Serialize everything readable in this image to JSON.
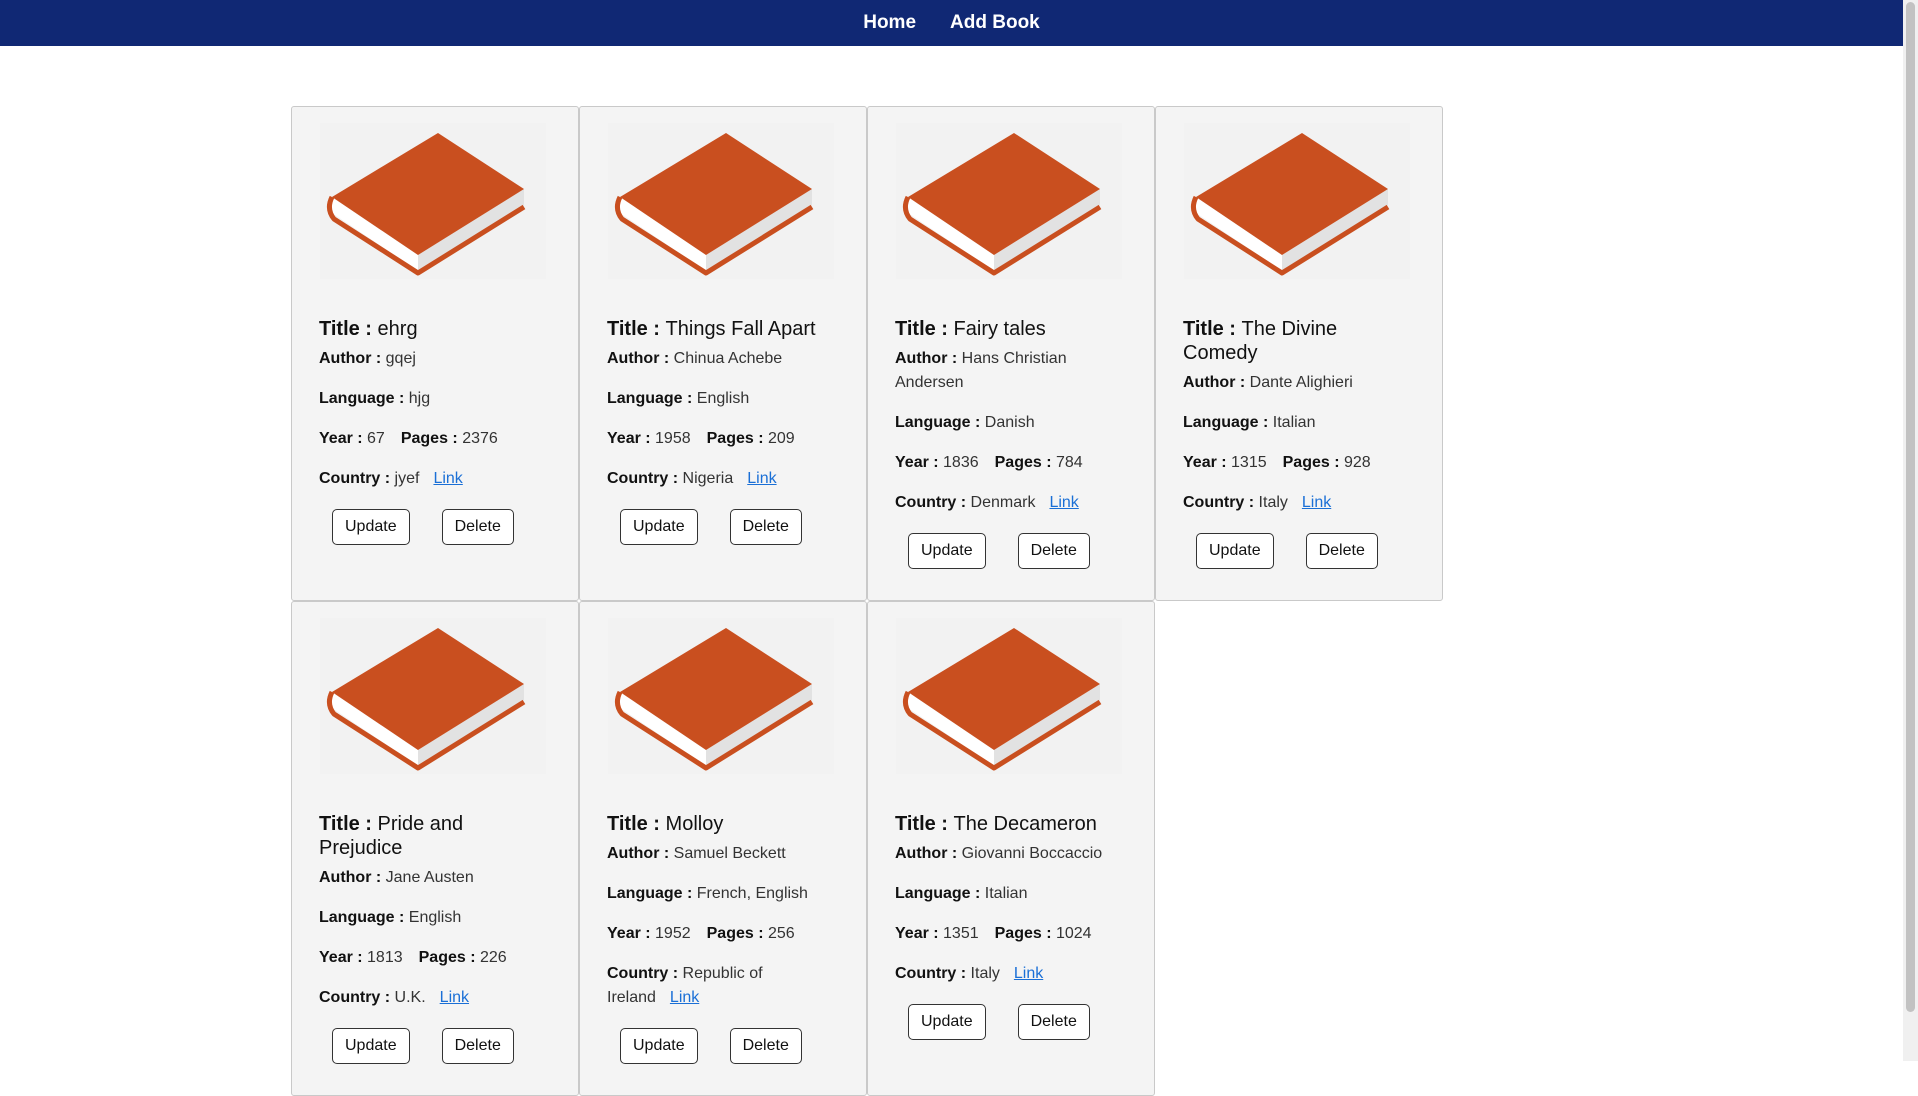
{
  "nav": {
    "home": "Home",
    "add_book": "Add Book"
  },
  "labels": {
    "title": "Title : ",
    "author": "Author : ",
    "language": "Language : ",
    "year": "Year : ",
    "pages": "Pages : ",
    "country": "Country : ",
    "link": "Link",
    "update": "Update",
    "delete": "Delete"
  },
  "colors": {
    "navbar": "#102874",
    "book_cover": "#c94f1f",
    "link": "#1a6fd6"
  },
  "books": [
    {
      "title": "ehrg",
      "author": "gqej",
      "language": "hjg",
      "year": "67",
      "pages": "2376",
      "country": "jyef"
    },
    {
      "title": "Things Fall Apart",
      "author": "Chinua Achebe",
      "language": "English",
      "year": "1958",
      "pages": "209",
      "country": "Nigeria"
    },
    {
      "title": "Fairy tales",
      "author": "Hans Christian Andersen",
      "language": "Danish",
      "year": "1836",
      "pages": "784",
      "country": "Denmark"
    },
    {
      "title": "The Divine Comedy",
      "author": "Dante Alighieri",
      "language": "Italian",
      "year": "1315",
      "pages": "928",
      "country": "Italy"
    },
    {
      "title": "Pride and Prejudice",
      "author": "Jane Austen",
      "language": "English",
      "year": "1813",
      "pages": "226",
      "country": "U.K."
    },
    {
      "title": "Molloy",
      "author": "Samuel Beckett",
      "language": "French, English",
      "year": "1952",
      "pages": "256",
      "country": "Republic of Ireland"
    },
    {
      "title": "The Decameron",
      "author": "Giovanni Boccaccio",
      "language": "Italian",
      "year": "1351",
      "pages": "1024",
      "country": "Italy"
    }
  ]
}
